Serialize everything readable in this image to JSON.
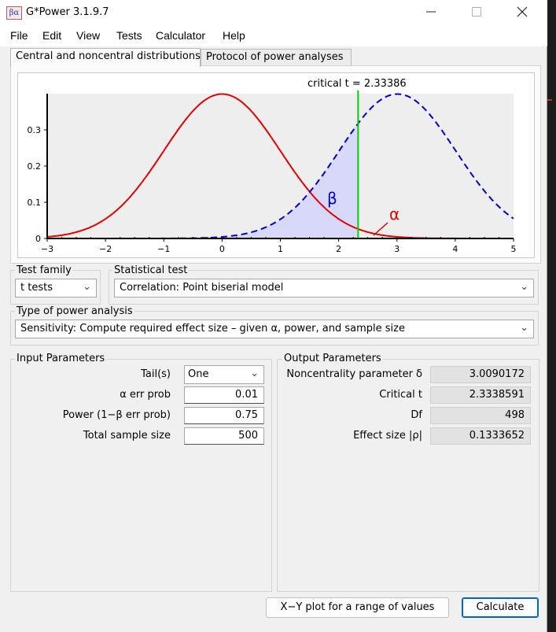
{
  "window": {
    "title": "G*Power 3.1.9.7",
    "icon_text": "βα",
    "minimize_icon": "minimize-icon",
    "maximize_icon": "maximize-icon",
    "close_icon": "close-icon"
  },
  "menu": [
    "File",
    "Edit",
    "View",
    "Tests",
    "Calculator",
    "Help"
  ],
  "tabs": {
    "distributions": "Central and noncentral distributions",
    "protocol": "Protocol of power analyses"
  },
  "plot": {
    "critical_label": "critical t =  2.33386",
    "beta_label": "β",
    "alpha_label": "α",
    "y_ticks": [
      "0",
      "0.1",
      "0.2",
      "0.3"
    ],
    "x_ticks": [
      "−3",
      "−2",
      "−1",
      "0",
      "1",
      "2",
      "3",
      "4",
      "5"
    ],
    "central_color": "#e00000",
    "noncentral_color": "#0000cc",
    "critical_color": "#00d000",
    "beta_fill": "#d8d8fb",
    "critical_t": 2.33386,
    "noncentrality": 3.0090172
  },
  "test_family": {
    "label": "Test family",
    "value": "t tests"
  },
  "statistical_test": {
    "label": "Statistical test",
    "value": "Correlation: Point biserial model"
  },
  "power_analysis": {
    "label": "Type of power analysis",
    "value": "Sensitivity: Compute required effect size – given α, power, and sample size"
  },
  "input": {
    "label": "Input Parameters",
    "tails_label": "Tail(s)",
    "tails_value": "One",
    "alpha_label": "α err prob",
    "alpha_value": "0.01",
    "power_label": "Power (1−β err prob)",
    "power_value": "0.75",
    "n_label": "Total sample size",
    "n_value": "500"
  },
  "output": {
    "label": "Output Parameters",
    "nc_label": "Noncentrality parameter δ",
    "nc_value": "3.0090172",
    "crit_label": "Critical t",
    "crit_value": "2.3338591",
    "df_label": "Df",
    "df_value": "498",
    "es_label": "Effect size |ρ|",
    "es_value": "0.1333652"
  },
  "buttons": {
    "xy_plot": "X−Y plot for a range of values",
    "calculate": "Calculate"
  },
  "accent_color": "#0067c0"
}
